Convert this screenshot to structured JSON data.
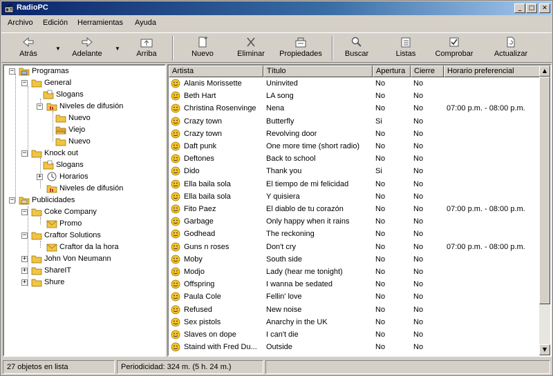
{
  "window": {
    "title": "RadioPC"
  },
  "menu": [
    "Archivo",
    "Edición",
    "Herramientas",
    "Ayuda"
  ],
  "toolbar": {
    "back": "Atrás",
    "forward": "Adelante",
    "up": "Arriba",
    "new": "Nuevo",
    "delete": "Eliminar",
    "properties": "Propiedades",
    "search": "Buscar",
    "lists": "Listas",
    "check": "Comprobar",
    "update": "Actualizar"
  },
  "tree": {
    "programas": "Programas",
    "general": "General",
    "slogans1": "Slogans",
    "niveles1": "Niveles de difusión",
    "nuevo1": "Nuevo",
    "viejo": "Viejo",
    "nuevo2": "Nuevo",
    "knockout": "Knock out",
    "slogans2": "Slogans",
    "horarios": "Horarios",
    "niveles2": "Niveles de difusión",
    "publicidades": "Publicidades",
    "coke": "Coke Company",
    "promo": "Promo",
    "craftor": "Craftor Solutions",
    "craftor_hora": "Craftor da la hora",
    "john": "John Von Neumann",
    "sharet": "ShareIT",
    "shure": "Shure"
  },
  "list": {
    "columns": [
      "Artista",
      "Título",
      "Apertura",
      "Cierre",
      "Horario preferencial"
    ],
    "rows": [
      [
        "Alanis Morissette",
        "Uninvited",
        "No",
        "No",
        ""
      ],
      [
        "Beth Hart",
        "LA song",
        "No",
        "No",
        ""
      ],
      [
        "Christina Rosenvinge",
        "Nena",
        "No",
        "No",
        "07:00 p.m. - 08:00 p.m."
      ],
      [
        "Crazy town",
        "Butterfly",
        "Si",
        "No",
        ""
      ],
      [
        "Crazy town",
        "Revolving door",
        "No",
        "No",
        ""
      ],
      [
        "Daft punk",
        "One more time (short radio)",
        "No",
        "No",
        ""
      ],
      [
        "Deftones",
        "Back to school",
        "No",
        "No",
        ""
      ],
      [
        "Dido",
        "Thank you",
        "Si",
        "No",
        ""
      ],
      [
        "Ella baila sola",
        "El tiempo de mi felicidad",
        "No",
        "No",
        ""
      ],
      [
        "Ella baila sola",
        "Y quisiera",
        "No",
        "No",
        ""
      ],
      [
        "Fito Paez",
        "El diablo de tu corazón",
        "No",
        "No",
        "07:00 p.m. - 08:00 p.m."
      ],
      [
        "Garbage",
        "Only happy when it rains",
        "No",
        "No",
        ""
      ],
      [
        "Godhead",
        "The reckoning",
        "No",
        "No",
        ""
      ],
      [
        "Guns n roses",
        "Don't cry",
        "No",
        "No",
        "07:00 p.m. - 08:00 p.m."
      ],
      [
        "Moby",
        "South side",
        "No",
        "No",
        ""
      ],
      [
        "Modjo",
        "Lady (hear me tonight)",
        "No",
        "No",
        ""
      ],
      [
        "Offspring",
        "I wanna be sedated",
        "No",
        "No",
        ""
      ],
      [
        "Paula Cole",
        "Fellin' love",
        "No",
        "No",
        ""
      ],
      [
        "Refused",
        "New noise",
        "No",
        "No",
        ""
      ],
      [
        "Sex pistols",
        "Anarchy in the UK",
        "No",
        "No",
        ""
      ],
      [
        "Slaves on dope",
        "I can't die",
        "No",
        "No",
        ""
      ],
      [
        "Staind with Fred Du...",
        "Outside",
        "No",
        "No",
        ""
      ]
    ]
  },
  "status": {
    "count": "27 objetos en lista",
    "period": "Periodicidad: 324 m. (5 h. 24 m.)"
  }
}
